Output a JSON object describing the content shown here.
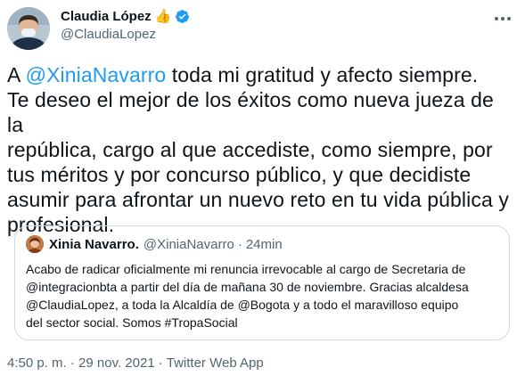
{
  "author": {
    "display_name": "Claudia López",
    "emoji": "👍",
    "handle": "@ClaudiaLopez"
  },
  "tweet": {
    "prefix": "A ",
    "mention": "@XiniaNavarro",
    "lines": [
      " toda mi gratitud y afecto siempre.",
      "Te deseo el mejor de los éxitos como nueva jueza de la",
      "república, cargo al que accediste, como siempre, por",
      "tus méritos y por concurso público, y que decidiste",
      "asumir para afrontar un nuevo reto en tu vida pública y",
      "profesional."
    ]
  },
  "quoted": {
    "display_name": "Xinia Navarro.",
    "handle": "@XiniaNavarro",
    "separator": "·",
    "time": "24min",
    "lines": [
      "Acabo de radicar oficialmente mi renuncia irrevocable al cargo de Secretaria de",
      "@integracionbta a partir del día de mañana 30 de noviembre. Gracias alcaldesa",
      "@ClaudiaLopez, a toda la Alcaldía de  @Bogota y a todo el maravilloso equipo",
      "del sector social. Somos  #TropaSocial"
    ]
  },
  "meta": {
    "time": "4:50 p. m.",
    "separator1": " · ",
    "date": "29 nov. 2021",
    "separator2": " · ",
    "source": "Twitter Web App"
  },
  "colors": {
    "accent": "#1d9bf0",
    "text": "#0f1419",
    "secondary": "#536471",
    "border": "#cfd9de"
  }
}
